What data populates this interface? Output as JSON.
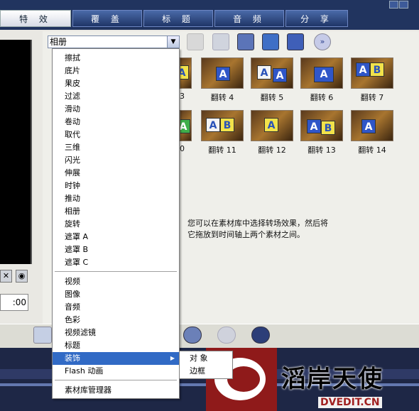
{
  "tabs": [
    {
      "label": "特  效",
      "active": true
    },
    {
      "label": "覆  盖"
    },
    {
      "label": "标  题"
    },
    {
      "label": "音  频"
    },
    {
      "label": "分  享"
    }
  ],
  "library": {
    "selected": "相册",
    "thumbnails": [
      {
        "label": "3"
      },
      {
        "label": "翻转 4"
      },
      {
        "label": "翻转 5"
      },
      {
        "label": "翻转 6"
      },
      {
        "label": "翻转 7"
      },
      {
        "label": "0"
      },
      {
        "label": "翻转 11"
      },
      {
        "label": "翻转 12"
      },
      {
        "label": "翻转 13"
      },
      {
        "label": "翻转 14"
      }
    ],
    "info_lines": [
      "您可以在素材库中选择转场效果，然后将",
      "它拖放到时间轴上两个素材之间。"
    ]
  },
  "preview": {
    "timecode": ":00"
  },
  "menu": {
    "group1": [
      "擦拭",
      "底片",
      "果皮",
      "过滤",
      "滑动",
      "卷动",
      "取代",
      "三维",
      "闪光",
      "伸展",
      "时钟",
      "推动",
      "相册",
      "旋转",
      "遮罩 A",
      "遮罩 B",
      "遮罩 C"
    ],
    "group2": [
      "视频",
      "图像",
      "音频",
      "色彩",
      "视频滤镜",
      "标题",
      "装饰",
      "Flash 动画"
    ],
    "group3": [
      "素材库管理器"
    ],
    "highlighted": "装饰",
    "submenu": [
      "对 象",
      "边框"
    ]
  },
  "watermark": {
    "brand": "滔岸天使",
    "url": "DVEDIT.CN"
  },
  "colors": {
    "accent": "#316ac5",
    "topbar": "#21345f"
  }
}
